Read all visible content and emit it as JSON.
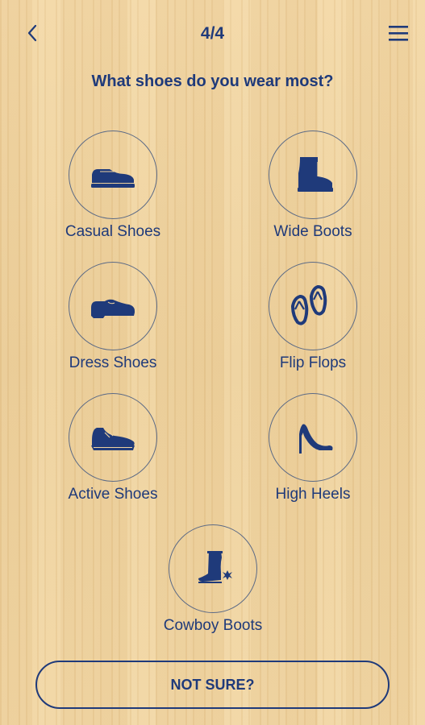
{
  "header": {
    "step": "4/4"
  },
  "question": "What shoes do you wear most?",
  "options": [
    {
      "label": "Casual Shoes",
      "icon": "casual-shoe-icon"
    },
    {
      "label": "Wide Boots",
      "icon": "wide-boot-icon"
    },
    {
      "label": "Dress Shoes",
      "icon": "dress-shoe-icon"
    },
    {
      "label": "Flip Flops",
      "icon": "flip-flops-icon"
    },
    {
      "label": "Active Shoes",
      "icon": "sneaker-icon"
    },
    {
      "label": "High Heels",
      "icon": "high-heel-icon"
    },
    {
      "label": "Cowboy Boots",
      "icon": "cowboy-boot-icon"
    }
  ],
  "not_sure_label": "NOT SURE?",
  "colors": {
    "primary": "#1f3a7a",
    "background": "#efd3a0",
    "circle_border": "#5b6a86"
  }
}
